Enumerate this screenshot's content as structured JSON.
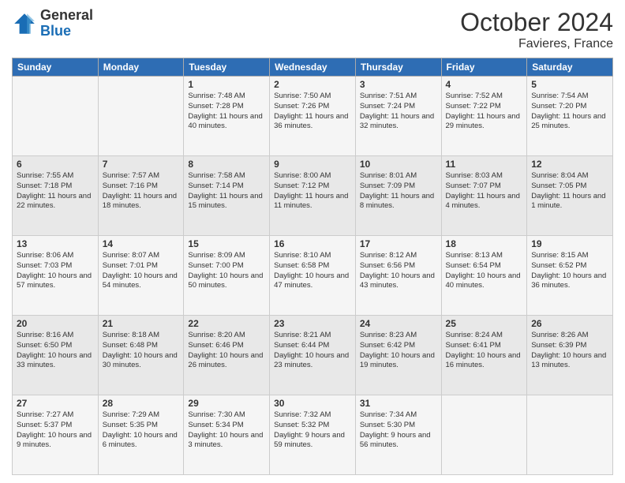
{
  "header": {
    "logo": {
      "line1": "General",
      "line2": "Blue"
    },
    "title": "October 2024",
    "subtitle": "Favieres, France"
  },
  "days_of_week": [
    "Sunday",
    "Monday",
    "Tuesday",
    "Wednesday",
    "Thursday",
    "Friday",
    "Saturday"
  ],
  "weeks": [
    [
      {
        "day": "",
        "sunrise": "",
        "sunset": "",
        "daylight": ""
      },
      {
        "day": "",
        "sunrise": "",
        "sunset": "",
        "daylight": ""
      },
      {
        "day": "1",
        "sunrise": "Sunrise: 7:48 AM",
        "sunset": "Sunset: 7:28 PM",
        "daylight": "Daylight: 11 hours and 40 minutes."
      },
      {
        "day": "2",
        "sunrise": "Sunrise: 7:50 AM",
        "sunset": "Sunset: 7:26 PM",
        "daylight": "Daylight: 11 hours and 36 minutes."
      },
      {
        "day": "3",
        "sunrise": "Sunrise: 7:51 AM",
        "sunset": "Sunset: 7:24 PM",
        "daylight": "Daylight: 11 hours and 32 minutes."
      },
      {
        "day": "4",
        "sunrise": "Sunrise: 7:52 AM",
        "sunset": "Sunset: 7:22 PM",
        "daylight": "Daylight: 11 hours and 29 minutes."
      },
      {
        "day": "5",
        "sunrise": "Sunrise: 7:54 AM",
        "sunset": "Sunset: 7:20 PM",
        "daylight": "Daylight: 11 hours and 25 minutes."
      }
    ],
    [
      {
        "day": "6",
        "sunrise": "Sunrise: 7:55 AM",
        "sunset": "Sunset: 7:18 PM",
        "daylight": "Daylight: 11 hours and 22 minutes."
      },
      {
        "day": "7",
        "sunrise": "Sunrise: 7:57 AM",
        "sunset": "Sunset: 7:16 PM",
        "daylight": "Daylight: 11 hours and 18 minutes."
      },
      {
        "day": "8",
        "sunrise": "Sunrise: 7:58 AM",
        "sunset": "Sunset: 7:14 PM",
        "daylight": "Daylight: 11 hours and 15 minutes."
      },
      {
        "day": "9",
        "sunrise": "Sunrise: 8:00 AM",
        "sunset": "Sunset: 7:12 PM",
        "daylight": "Daylight: 11 hours and 11 minutes."
      },
      {
        "day": "10",
        "sunrise": "Sunrise: 8:01 AM",
        "sunset": "Sunset: 7:09 PM",
        "daylight": "Daylight: 11 hours and 8 minutes."
      },
      {
        "day": "11",
        "sunrise": "Sunrise: 8:03 AM",
        "sunset": "Sunset: 7:07 PM",
        "daylight": "Daylight: 11 hours and 4 minutes."
      },
      {
        "day": "12",
        "sunrise": "Sunrise: 8:04 AM",
        "sunset": "Sunset: 7:05 PM",
        "daylight": "Daylight: 11 hours and 1 minute."
      }
    ],
    [
      {
        "day": "13",
        "sunrise": "Sunrise: 8:06 AM",
        "sunset": "Sunset: 7:03 PM",
        "daylight": "Daylight: 10 hours and 57 minutes."
      },
      {
        "day": "14",
        "sunrise": "Sunrise: 8:07 AM",
        "sunset": "Sunset: 7:01 PM",
        "daylight": "Daylight: 10 hours and 54 minutes."
      },
      {
        "day": "15",
        "sunrise": "Sunrise: 8:09 AM",
        "sunset": "Sunset: 7:00 PM",
        "daylight": "Daylight: 10 hours and 50 minutes."
      },
      {
        "day": "16",
        "sunrise": "Sunrise: 8:10 AM",
        "sunset": "Sunset: 6:58 PM",
        "daylight": "Daylight: 10 hours and 47 minutes."
      },
      {
        "day": "17",
        "sunrise": "Sunrise: 8:12 AM",
        "sunset": "Sunset: 6:56 PM",
        "daylight": "Daylight: 10 hours and 43 minutes."
      },
      {
        "day": "18",
        "sunrise": "Sunrise: 8:13 AM",
        "sunset": "Sunset: 6:54 PM",
        "daylight": "Daylight: 10 hours and 40 minutes."
      },
      {
        "day": "19",
        "sunrise": "Sunrise: 8:15 AM",
        "sunset": "Sunset: 6:52 PM",
        "daylight": "Daylight: 10 hours and 36 minutes."
      }
    ],
    [
      {
        "day": "20",
        "sunrise": "Sunrise: 8:16 AM",
        "sunset": "Sunset: 6:50 PM",
        "daylight": "Daylight: 10 hours and 33 minutes."
      },
      {
        "day": "21",
        "sunrise": "Sunrise: 8:18 AM",
        "sunset": "Sunset: 6:48 PM",
        "daylight": "Daylight: 10 hours and 30 minutes."
      },
      {
        "day": "22",
        "sunrise": "Sunrise: 8:20 AM",
        "sunset": "Sunset: 6:46 PM",
        "daylight": "Daylight: 10 hours and 26 minutes."
      },
      {
        "day": "23",
        "sunrise": "Sunrise: 8:21 AM",
        "sunset": "Sunset: 6:44 PM",
        "daylight": "Daylight: 10 hours and 23 minutes."
      },
      {
        "day": "24",
        "sunrise": "Sunrise: 8:23 AM",
        "sunset": "Sunset: 6:42 PM",
        "daylight": "Daylight: 10 hours and 19 minutes."
      },
      {
        "day": "25",
        "sunrise": "Sunrise: 8:24 AM",
        "sunset": "Sunset: 6:41 PM",
        "daylight": "Daylight: 10 hours and 16 minutes."
      },
      {
        "day": "26",
        "sunrise": "Sunrise: 8:26 AM",
        "sunset": "Sunset: 6:39 PM",
        "daylight": "Daylight: 10 hours and 13 minutes."
      }
    ],
    [
      {
        "day": "27",
        "sunrise": "Sunrise: 7:27 AM",
        "sunset": "Sunset: 5:37 PM",
        "daylight": "Daylight: 10 hours and 9 minutes."
      },
      {
        "day": "28",
        "sunrise": "Sunrise: 7:29 AM",
        "sunset": "Sunset: 5:35 PM",
        "daylight": "Daylight: 10 hours and 6 minutes."
      },
      {
        "day": "29",
        "sunrise": "Sunrise: 7:30 AM",
        "sunset": "Sunset: 5:34 PM",
        "daylight": "Daylight: 10 hours and 3 minutes."
      },
      {
        "day": "30",
        "sunrise": "Sunrise: 7:32 AM",
        "sunset": "Sunset: 5:32 PM",
        "daylight": "Daylight: 9 hours and 59 minutes."
      },
      {
        "day": "31",
        "sunrise": "Sunrise: 7:34 AM",
        "sunset": "Sunset: 5:30 PM",
        "daylight": "Daylight: 9 hours and 56 minutes."
      },
      {
        "day": "",
        "sunrise": "",
        "sunset": "",
        "daylight": ""
      },
      {
        "day": "",
        "sunrise": "",
        "sunset": "",
        "daylight": ""
      }
    ]
  ]
}
